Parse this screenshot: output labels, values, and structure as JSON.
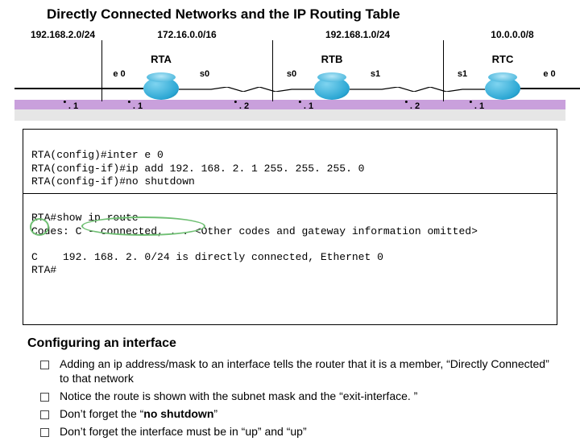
{
  "title": "Directly Connected Networks and the IP Routing Table",
  "topology": {
    "nets": {
      "n0": "192.168.2.0/24",
      "n1": "172.16.0.0/16",
      "n2": "192.168.1.0/24",
      "n3": "10.0.0.0/8"
    },
    "routers": {
      "r0": "RTA",
      "r1": "RTB",
      "r2": "RTC"
    },
    "ifs": {
      "a_e0": "e 0",
      "a_s0": "s0",
      "b_s0": "s0",
      "b_s1": "s1",
      "c_s1": "s1",
      "c_e0": "e 0"
    },
    "ips": {
      "p0": ". 1",
      "p1": ". 1",
      "p2": ". 2",
      "p3": ". 1",
      "p4": ". 2",
      "p5": ". 1"
    }
  },
  "terminal": {
    "l1": "RTA(config)#inter e 0",
    "l2": "RTA(config-if)#ip add 192. 168. 2. 1 255. 255. 255. 0",
    "l3": "RTA(config-if)#no shutdown",
    "l4": "RTA#show ip route",
    "l5": "Codes: C - connected, . . <Other codes and gateway information omitted>",
    "l6": "C    192. 168. 2. 0/24 is directly connected, Ethernet 0",
    "l7": "RTA#"
  },
  "subheading": "Configuring an interface",
  "bullets": {
    "b0": "Adding an ip address/mask to an interface tells the router that it is a member, “Directly Connected” to that network",
    "b1": "Notice the route is shown with the subnet mask and the “exit-interface. ”",
    "b2a": "Don’t forget the “",
    "b2b": "no shutdown",
    "b2c": "”",
    "b3": "Don’t forget the interface must be in “up” and “up”"
  }
}
